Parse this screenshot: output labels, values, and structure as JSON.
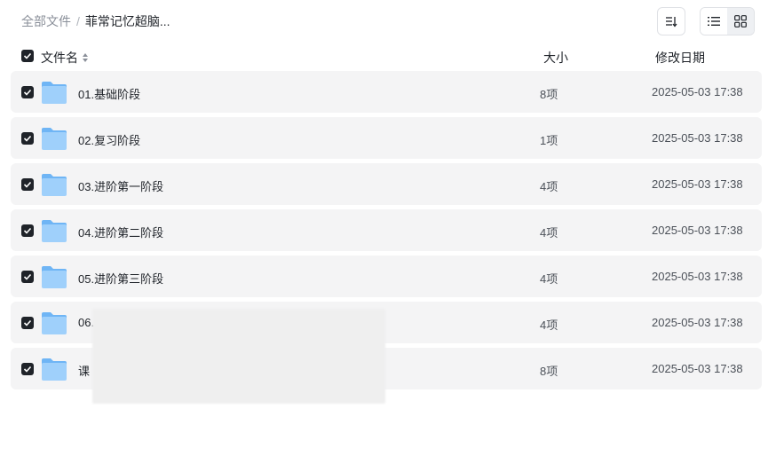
{
  "breadcrumb": {
    "root": "全部文件",
    "separator": "/",
    "current": "菲常记忆超脑..."
  },
  "toolbar": {
    "sort_icon": "sort-icon",
    "list_view_icon": "list-view-icon",
    "grid_view_icon": "grid-view-icon"
  },
  "table": {
    "headers": {
      "name": "文件名",
      "size": "大小",
      "date": "修改日期"
    },
    "rows": [
      {
        "name": "01.基础阶段",
        "size": "8项",
        "date": "2025-05-03 17:38"
      },
      {
        "name": "02.复习阶段",
        "size": "1项",
        "date": "2025-05-03 17:38"
      },
      {
        "name": "03.进阶第一阶段",
        "size": "4项",
        "date": "2025-05-03 17:38"
      },
      {
        "name": "04.进阶第二阶段",
        "size": "4项",
        "date": "2025-05-03 17:38"
      },
      {
        "name": "05.进阶第三阶段",
        "size": "4项",
        "date": "2025-05-03 17:38"
      },
      {
        "name": "06.",
        "size": "4项",
        "date": "2025-05-03 17:38"
      },
      {
        "name": "课",
        "size": "8项",
        "date": "2025-05-03 17:38"
      }
    ]
  },
  "colors": {
    "row_background": "#f4f4f5",
    "checkbox": "#1f2329",
    "folder_light": "#9fd0fb",
    "folder_dark": "#6fb5f5"
  }
}
